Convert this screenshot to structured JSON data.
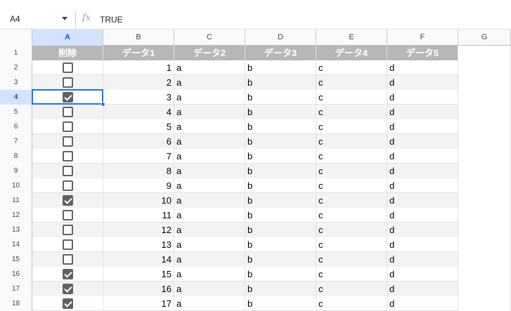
{
  "formula_bar": {
    "name_box": "A4",
    "fx_icon": "function-icon",
    "value": "TRUE"
  },
  "columns": [
    "A",
    "B",
    "C",
    "D",
    "E",
    "F",
    "G"
  ],
  "selected_column": "A",
  "selected_row": "4",
  "header_row": {
    "row_number": "1",
    "labels": [
      "削除",
      "データ1",
      "データ2",
      "データ3",
      "データ4",
      "データ5"
    ]
  },
  "rows": [
    {
      "n": "2",
      "checked": false,
      "d1": "1",
      "d2": "a",
      "d3": "b",
      "d4": "c",
      "d5": "d"
    },
    {
      "n": "3",
      "checked": false,
      "d1": "2",
      "d2": "a",
      "d3": "b",
      "d4": "c",
      "d5": "d"
    },
    {
      "n": "4",
      "checked": true,
      "d1": "3",
      "d2": "a",
      "d3": "b",
      "d4": "c",
      "d5": "d"
    },
    {
      "n": "5",
      "checked": false,
      "d1": "4",
      "d2": "a",
      "d3": "b",
      "d4": "c",
      "d5": "d"
    },
    {
      "n": "6",
      "checked": false,
      "d1": "5",
      "d2": "a",
      "d3": "b",
      "d4": "c",
      "d5": "d"
    },
    {
      "n": "7",
      "checked": false,
      "d1": "6",
      "d2": "a",
      "d3": "b",
      "d4": "c",
      "d5": "d"
    },
    {
      "n": "8",
      "checked": false,
      "d1": "7",
      "d2": "a",
      "d3": "b",
      "d4": "c",
      "d5": "d"
    },
    {
      "n": "9",
      "checked": false,
      "d1": "8",
      "d2": "a",
      "d3": "b",
      "d4": "c",
      "d5": "d"
    },
    {
      "n": "10",
      "checked": false,
      "d1": "9",
      "d2": "a",
      "d3": "b",
      "d4": "c",
      "d5": "d"
    },
    {
      "n": "11",
      "checked": true,
      "d1": "10",
      "d2": "a",
      "d3": "b",
      "d4": "c",
      "d5": "d"
    },
    {
      "n": "12",
      "checked": false,
      "d1": "11",
      "d2": "a",
      "d3": "b",
      "d4": "c",
      "d5": "d"
    },
    {
      "n": "13",
      "checked": false,
      "d1": "12",
      "d2": "a",
      "d3": "b",
      "d4": "c",
      "d5": "d"
    },
    {
      "n": "14",
      "checked": false,
      "d1": "13",
      "d2": "a",
      "d3": "b",
      "d4": "c",
      "d5": "d"
    },
    {
      "n": "15",
      "checked": false,
      "d1": "14",
      "d2": "a",
      "d3": "b",
      "d4": "c",
      "d5": "d"
    },
    {
      "n": "16",
      "checked": true,
      "d1": "15",
      "d2": "a",
      "d3": "b",
      "d4": "c",
      "d5": "d"
    },
    {
      "n": "17",
      "checked": true,
      "d1": "16",
      "d2": "a",
      "d3": "b",
      "d4": "c",
      "d5": "d"
    },
    {
      "n": "18",
      "checked": true,
      "d1": "17",
      "d2": "a",
      "d3": "b",
      "d4": "c",
      "d5": "d"
    }
  ],
  "colors": {
    "header_fill": "#b7b7b7",
    "band_fill": "#f3f3f3",
    "selection": "#1a73e8"
  }
}
